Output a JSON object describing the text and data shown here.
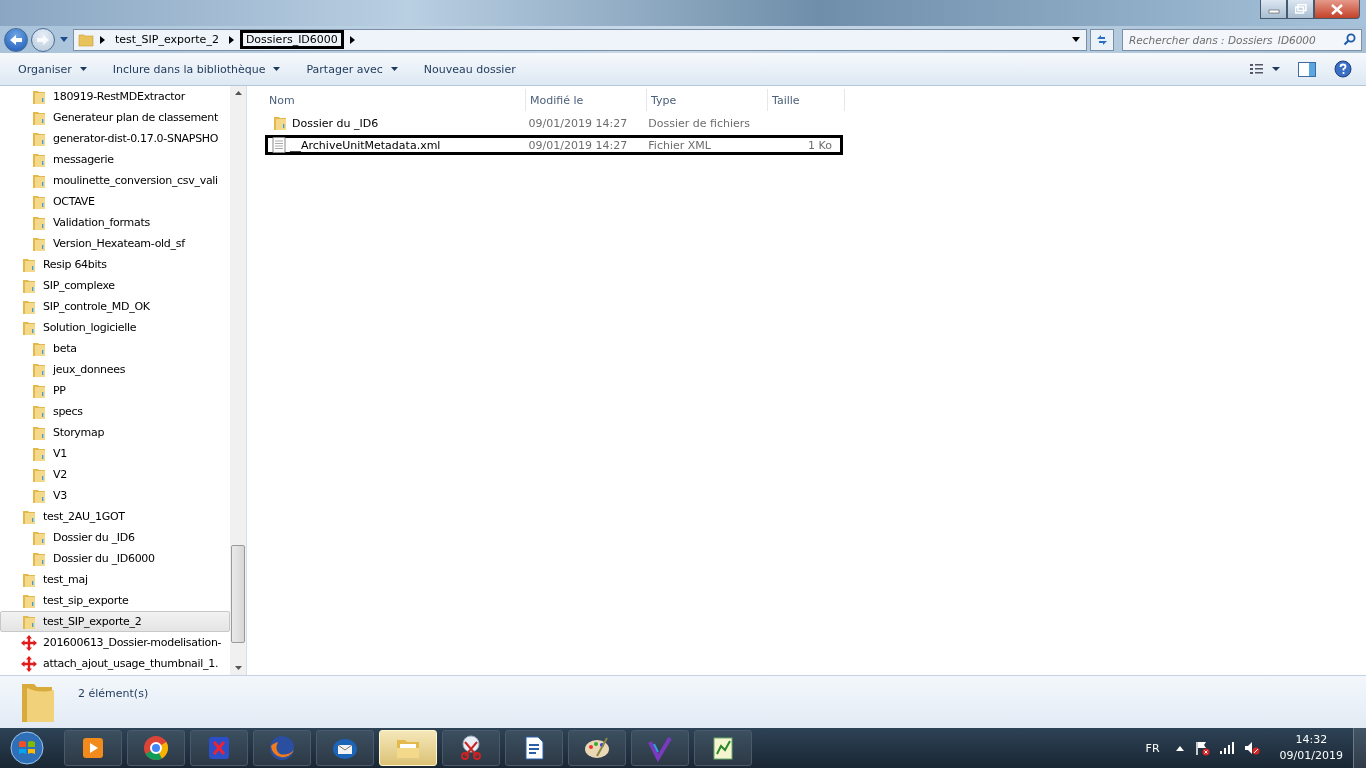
{
  "address_bar": {
    "segments": [
      {
        "label": "test_SIP_exporte_2",
        "highlighted": false
      },
      {
        "label": "Dossiers_ID6000",
        "highlighted": true
      }
    ],
    "search": {
      "placeholder": "Rechercher dans : Dossiers_ID6000"
    }
  },
  "toolbar": {
    "buttons": [
      {
        "label": "Organiser",
        "dropdown": true
      },
      {
        "label": "Inclure dans la bibliothèque",
        "dropdown": true
      },
      {
        "label": "Partager avec",
        "dropdown": true
      },
      {
        "label": "Nouveau dossier",
        "dropdown": false
      }
    ]
  },
  "sidebar": {
    "items": [
      {
        "children": [
          {
            "label": "180919-RestMDExtractor",
            "kind": "folder",
            "selected": false
          },
          {
            "label": "Generateur plan de classement",
            "kind": "folder",
            "selected": false
          },
          {
            "label": "generator-dist-0.17.0-SNAPSHO",
            "kind": "folder",
            "selected": false
          },
          {
            "label": "messagerie",
            "kind": "folder",
            "selected": false
          },
          {
            "label": "moulinette_conversion_csv_vali",
            "kind": "folder",
            "selected": false
          },
          {
            "label": "OCTAVE",
            "kind": "folder",
            "selected": false
          },
          {
            "label": "Validation_formats",
            "kind": "folder",
            "selected": false
          },
          {
            "label": "Version_Hexateam-old_sf",
            "kind": "folder",
            "selected": false
          }
        ]
      },
      {
        "label": "Resip 64bits",
        "kind": "folder",
        "selected": false
      },
      {
        "label": "SIP_complexe",
        "kind": "folder",
        "selected": false
      },
      {
        "label": "SIP_controle_MD_OK",
        "kind": "folder",
        "selected": false
      },
      {
        "label": "Solution_logicielle",
        "kind": "folder",
        "selected": false,
        "children": [
          {
            "label": "beta",
            "kind": "folder",
            "selected": false
          },
          {
            "label": "jeux_donnees",
            "kind": "folder",
            "selected": false
          },
          {
            "label": "PP",
            "kind": "folder",
            "selected": false
          },
          {
            "label": "specs",
            "kind": "folder",
            "selected": false
          },
          {
            "label": "Storymap",
            "kind": "folder",
            "selected": false
          },
          {
            "label": "V1",
            "kind": "folder",
            "selected": false
          },
          {
            "label": "V2",
            "kind": "folder",
            "selected": false
          },
          {
            "label": "V3",
            "kind": "folder",
            "selected": false
          }
        ]
      },
      {
        "label": "test_2AU_1GOT",
        "kind": "folder",
        "selected": false,
        "children": [
          {
            "label": "Dossier du _ID6",
            "kind": "folder",
            "selected": false
          },
          {
            "label": "Dossier du _ID6000",
            "kind": "folder",
            "selected": false
          }
        ]
      },
      {
        "label": "test_maj",
        "kind": "folder",
        "selected": false
      },
      {
        "label": "test_sip_exporte",
        "kind": "folder",
        "selected": false
      },
      {
        "label": "test_SIP_exporte_2",
        "kind": "folder",
        "selected": true
      },
      {
        "label": "201600613_Dossier-modelisation-",
        "kind": "file",
        "selected": false
      },
      {
        "label": "attach_ajout_usage_thumbnail_1.",
        "kind": "file",
        "selected": false
      }
    ]
  },
  "file_list": {
    "columns": [
      "Nom",
      "Modifié le",
      "Type",
      "Taille"
    ],
    "rows": [
      {
        "name": "Dossier du _ID6",
        "modified": "09/01/2019 14:27",
        "type": "Dossier de fichiers",
        "size": "",
        "kind": "folder",
        "highlighted": false
      },
      {
        "name": "__ArchiveUnitMetadata.xml",
        "modified": "09/01/2019 14:27",
        "type": "Fichier XML",
        "size": "1 Ko",
        "kind": "document",
        "highlighted": true
      }
    ]
  },
  "status_bar": {
    "text": "2 élément(s)"
  },
  "taskbar": {
    "apps": [
      {
        "selected": false
      },
      {
        "selected": false
      },
      {
        "selected": false
      },
      {
        "selected": false
      },
      {
        "selected": false
      },
      {
        "selected": true
      },
      {
        "selected": false
      },
      {
        "selected": false
      },
      {
        "selected": false
      },
      {
        "selected": false
      },
      {
        "selected": false
      }
    ],
    "language": "FR",
    "time": "14:32",
    "date": "09/01/2019"
  }
}
